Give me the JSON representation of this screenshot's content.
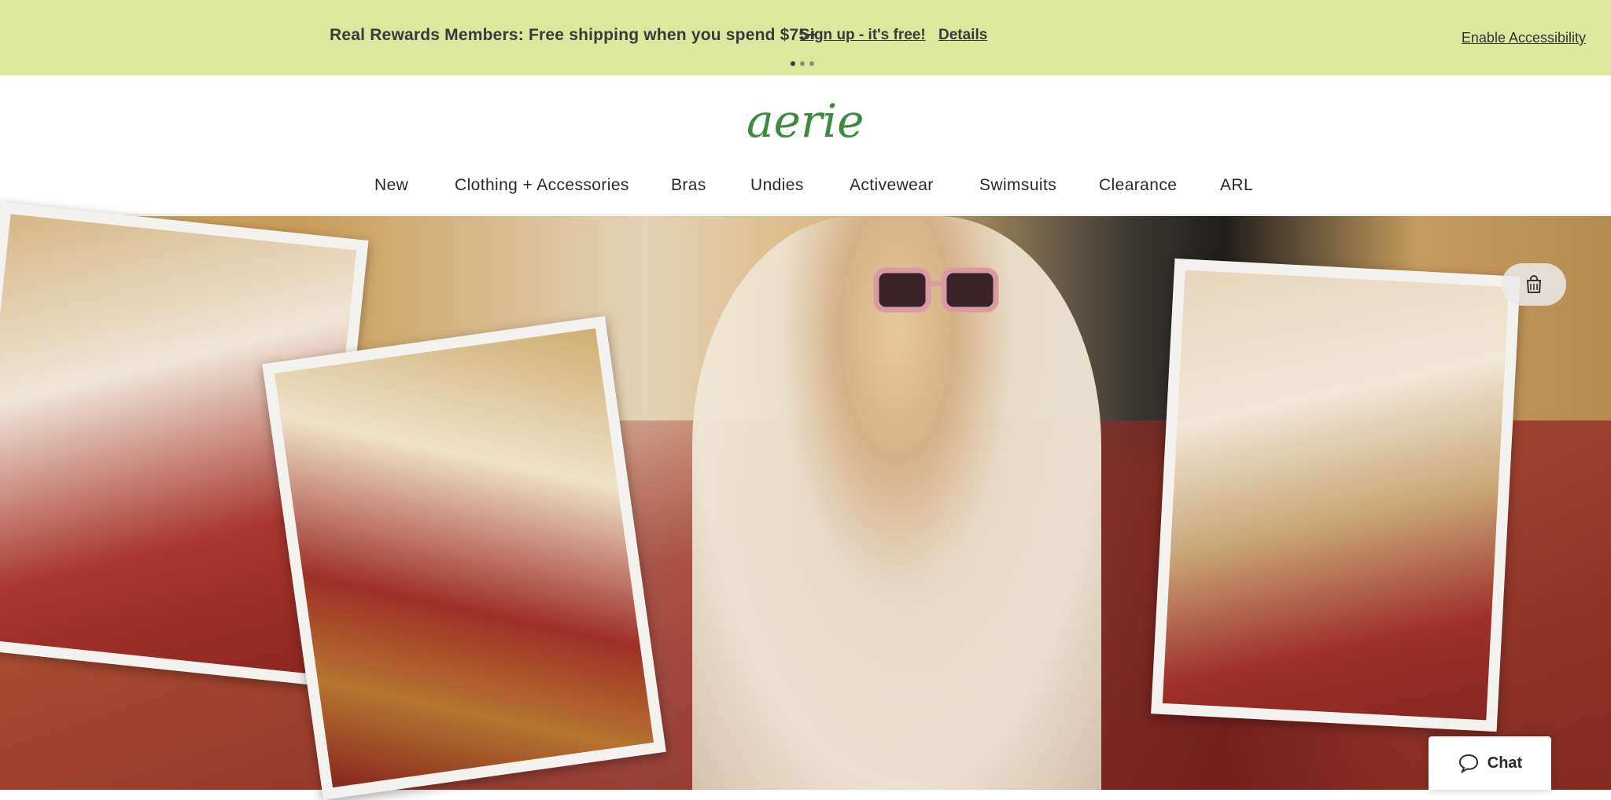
{
  "promo": {
    "message": "Real Rewards Members: Free shipping when you spend $75+",
    "signup_link": "Sign up - it's free!",
    "details_link": "Details",
    "accessibility_link": "Enable Accessibility",
    "background_color": "#dde89f"
  },
  "header": {
    "logo_text": "aerie",
    "logo_color": "#3b8a3e"
  },
  "nav": {
    "items": [
      {
        "label": "New"
      },
      {
        "label": "Clothing + Accessories"
      },
      {
        "label": "Bras"
      },
      {
        "label": "Undies"
      },
      {
        "label": "Activewear"
      },
      {
        "label": "Swimsuits"
      },
      {
        "label": "Clearance"
      },
      {
        "label": "ARL"
      }
    ]
  },
  "hero": {
    "bag_icon": "shopping-bag-icon"
  },
  "chat": {
    "label": "Chat",
    "icon": "chat-bubble-icon"
  }
}
